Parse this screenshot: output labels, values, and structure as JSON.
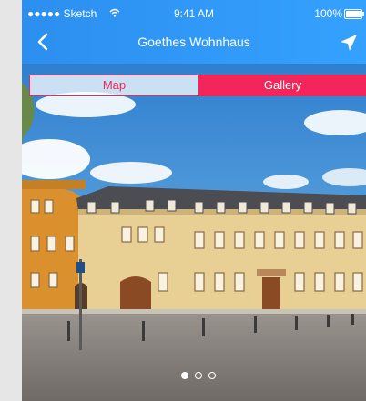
{
  "status_bar": {
    "carrier": "●●●●● Sketch",
    "time": "9:41 AM",
    "battery": "100%"
  },
  "nav": {
    "title": "Goethes Wohnhaus"
  },
  "segments": {
    "map": "Map",
    "gallery": "Gallery",
    "selected": "Gallery"
  },
  "gallery": {
    "page_index": 1,
    "page_count": 3
  },
  "icons": {
    "back": "chevron-left-icon",
    "locate": "location-arrow-icon",
    "wifi": "wifi-icon",
    "battery": "battery-icon"
  },
  "colors": {
    "nav_blue": "#2c8ff0",
    "accent_pink": "#f2265a"
  }
}
